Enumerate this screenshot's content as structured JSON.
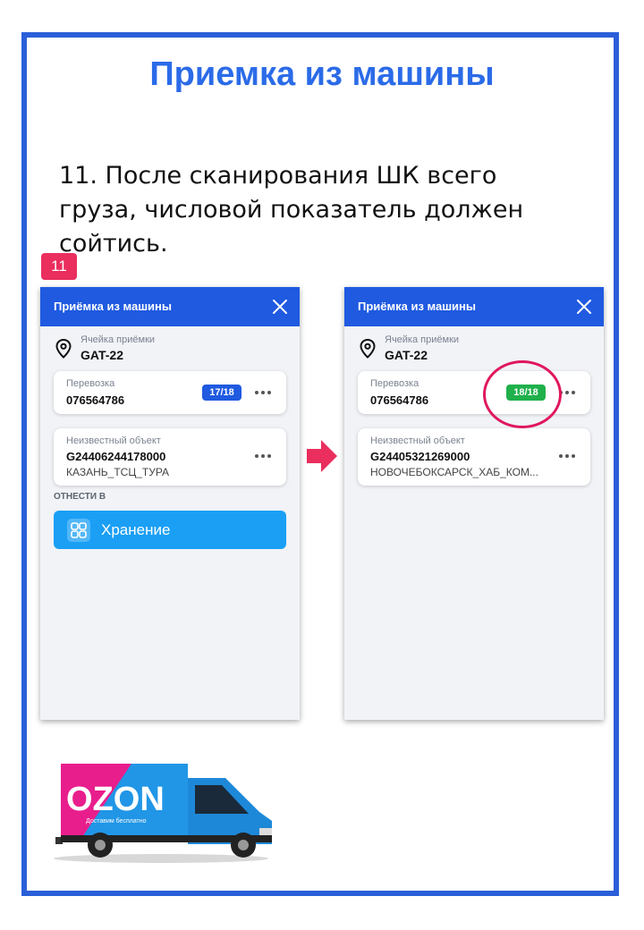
{
  "slide": {
    "title": "Приемка из машины",
    "instruction": "11. После сканирования ШК всего груза, числовой показатель должен сойтись.",
    "step_number": "11"
  },
  "colors": {
    "frame": "#2b5fd9",
    "title": "#2b6be8",
    "app_header": "#1f5ae0",
    "counter_pending": "#1f5ae0",
    "counter_done": "#1fb04b",
    "storage_button": "#1a9ff5",
    "highlight": "#e0175e",
    "arrow": "#ea2e5e"
  },
  "screens": {
    "before": {
      "header_title": "Приёмка из машины",
      "cell_label": "Ячейка приёмки",
      "cell_value": "GAT-22",
      "shipment_label": "Перевозка",
      "shipment_number": "076564786",
      "counter": "17/18",
      "object_label": "Неизвестный объект",
      "object_barcode": "G24406244178000",
      "object_destination": "КАЗАНЬ_ТСЦ_ТУРА",
      "move_to_label": "ОТНЕСТИ В",
      "storage_button_label": "Хранение"
    },
    "after": {
      "header_title": "Приёмка из машины",
      "cell_label": "Ячейка приёмки",
      "cell_value": "GAT-22",
      "shipment_label": "Перевозка",
      "shipment_number": "076564786",
      "counter": "18/18",
      "object_label": "Неизвестный объект",
      "object_barcode": "G24405321269000",
      "object_destination": "НОВОЧЕБОКСАРСК_ХАБ_КОМ..."
    }
  },
  "truck": {
    "brand": "OZON",
    "slogan": "Доставим бесплатно"
  }
}
